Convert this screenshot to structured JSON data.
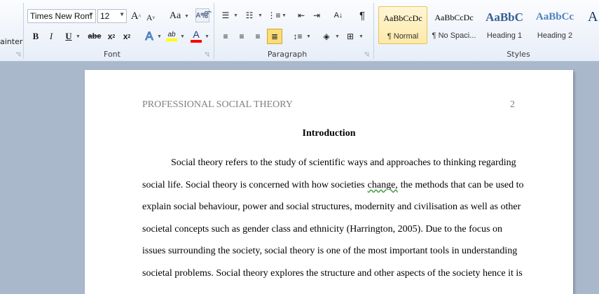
{
  "clipboard": {
    "painter_label": "ainter"
  },
  "font": {
    "group_label": "Font",
    "family": "Times New Rom",
    "size": "12",
    "grow_label": "A",
    "shrink_label": "A",
    "change_case_label": "Aa",
    "bold_label": "B",
    "italic_label": "I",
    "underline_label": "U",
    "strike_label": "abe",
    "subscript_label": "x",
    "superscript_label": "x",
    "text_effects_label": "A",
    "highlight_label": "ab",
    "font_color_label": "A",
    "colors": {
      "highlight": "#ffff00",
      "font_color": "#ff0000"
    }
  },
  "paragraph": {
    "group_label": "Paragraph",
    "pilcrow": "¶"
  },
  "styles": {
    "group_label": "Styles",
    "items": [
      {
        "sample": "AaBbCcDc",
        "name": "¶ Normal"
      },
      {
        "sample": "AaBbCcDc",
        "name": "¶ No Spaci..."
      },
      {
        "sample": "AaBbC",
        "name": "Heading 1"
      },
      {
        "sample": "AaBbCc",
        "name": "Heading 2"
      },
      {
        "sample": "A",
        "name": ""
      }
    ]
  },
  "document": {
    "header_left": "PROFESSIONAL SOCIAL THEORY",
    "page_number": "2",
    "heading": "Introduction",
    "lines": [
      "Social theory refers to the study of scientific ways and approaches to thinking regarding",
      "social life. Social theory is concerned with how societies",
      "change,",
      "the methods that can be used to",
      "explain social behaviour, power and social structures, modernity and civilisation as well as other",
      "societal concepts such as gender class and ethnicity (Harrington, 2005). Due to the focus on",
      "issues surrounding the society, social theory is one of the most important tools in understanding",
      "societal problems. Social theory explores the structure and other aspects of the society hence it is"
    ]
  }
}
